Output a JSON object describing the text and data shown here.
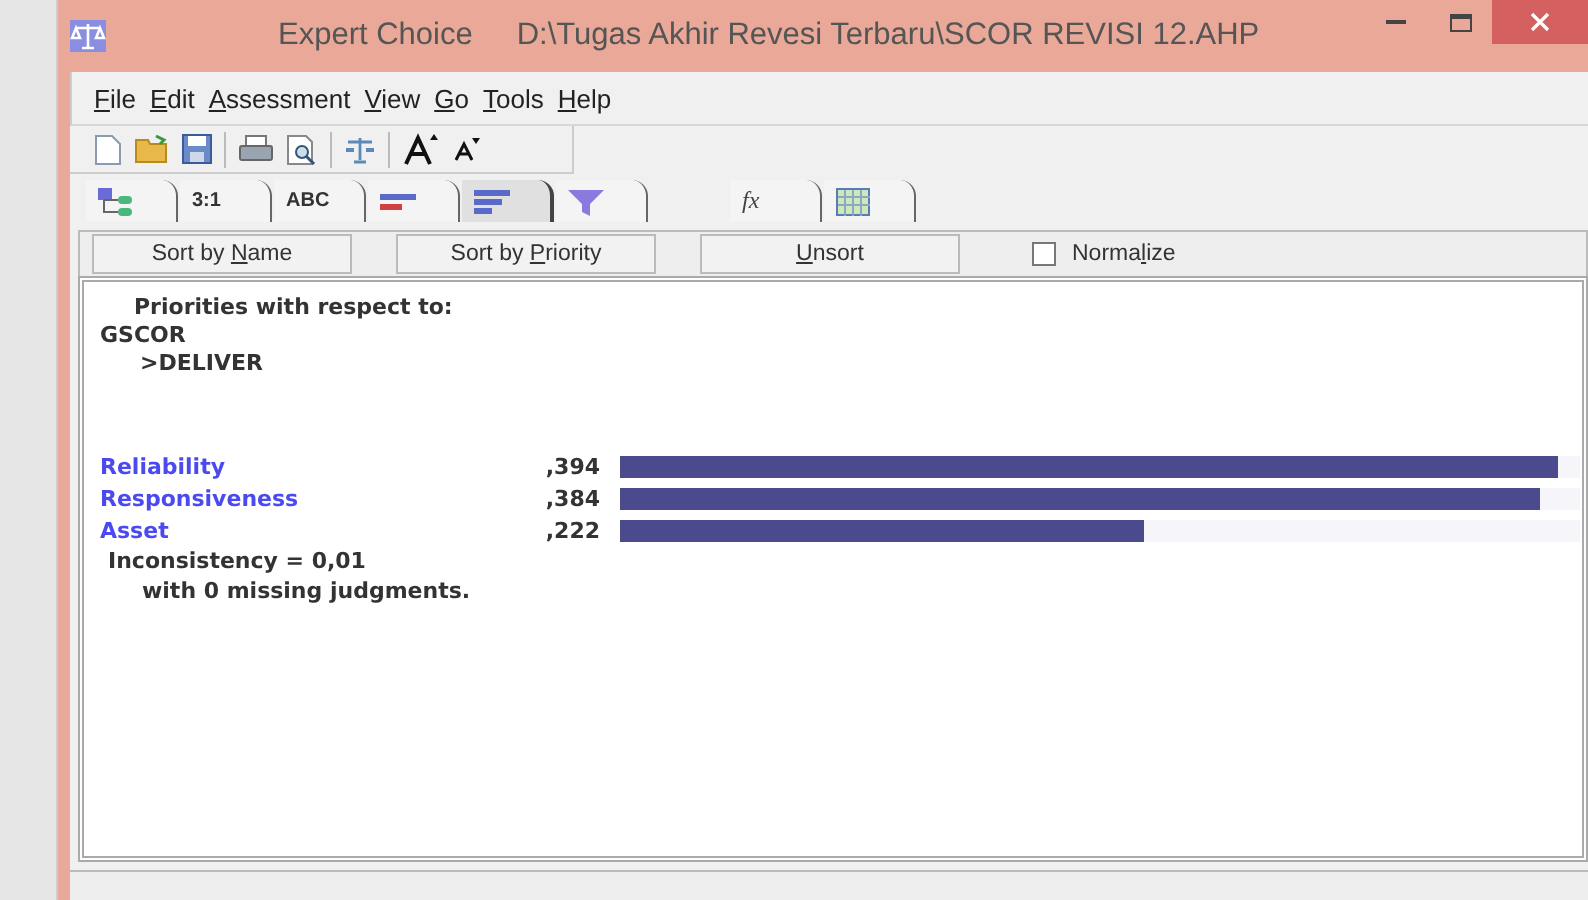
{
  "window": {
    "title": "Expert Choice",
    "path": "D:\\Tugas Akhir Revesi Terbaru\\SCOR REVISI 12.AHP"
  },
  "menu": [
    {
      "key": "F",
      "post": "ile"
    },
    {
      "key": "E",
      "post": "dit"
    },
    {
      "key": "A",
      "post": "ssessment"
    },
    {
      "key": "V",
      "post": "iew"
    },
    {
      "key": "G",
      "post": "o"
    },
    {
      "key": "T",
      "post": "ools"
    },
    {
      "key": "H",
      "post": "elp"
    }
  ],
  "toolbar": [
    {
      "kind": "new"
    },
    {
      "kind": "open"
    },
    {
      "kind": "save"
    },
    {
      "kind": "sep"
    },
    {
      "kind": "print"
    },
    {
      "kind": "preview"
    },
    {
      "kind": "sep"
    },
    {
      "kind": "scale"
    },
    {
      "kind": "sep"
    },
    {
      "kind": "font-up"
    },
    {
      "kind": "font-down"
    }
  ],
  "tabs": [
    {
      "kind": "tree",
      "selected": false
    },
    {
      "kind": "text",
      "label": "3:1",
      "selected": false
    },
    {
      "kind": "text",
      "label": "ABC",
      "selected": false
    },
    {
      "kind": "bars-red",
      "selected": false
    },
    {
      "kind": "bars",
      "selected": true
    },
    {
      "kind": "funnel",
      "selected": false
    },
    {
      "kind": "gap"
    },
    {
      "kind": "formula",
      "label": "fx",
      "selected": false
    },
    {
      "kind": "grid",
      "selected": false
    }
  ],
  "sort_buttons": [
    {
      "pre": "Sort by ",
      "key": "N",
      "post": "ame"
    },
    {
      "pre": "Sort by ",
      "key": "P",
      "post": "riority"
    },
    {
      "key": "U",
      "post": "nsort"
    }
  ],
  "normalize": {
    "pre": "Norma",
    "key": "l",
    "post": "ize",
    "checked": false
  },
  "heading": "Priorities with respect to:",
  "goal": "GSCOR",
  "node": ">DELIVER",
  "priorities": [
    {
      "name": "Reliability",
      "value": ",394",
      "level": 0.977
    },
    {
      "name": "Responsiveness",
      "value": ",384",
      "level": 0.958
    },
    {
      "name": "Asset",
      "value": ",222",
      "level": 0.546
    }
  ],
  "inconsistency": "Inconsistency = 0,01",
  "missing": "with 0  missing judgments."
}
